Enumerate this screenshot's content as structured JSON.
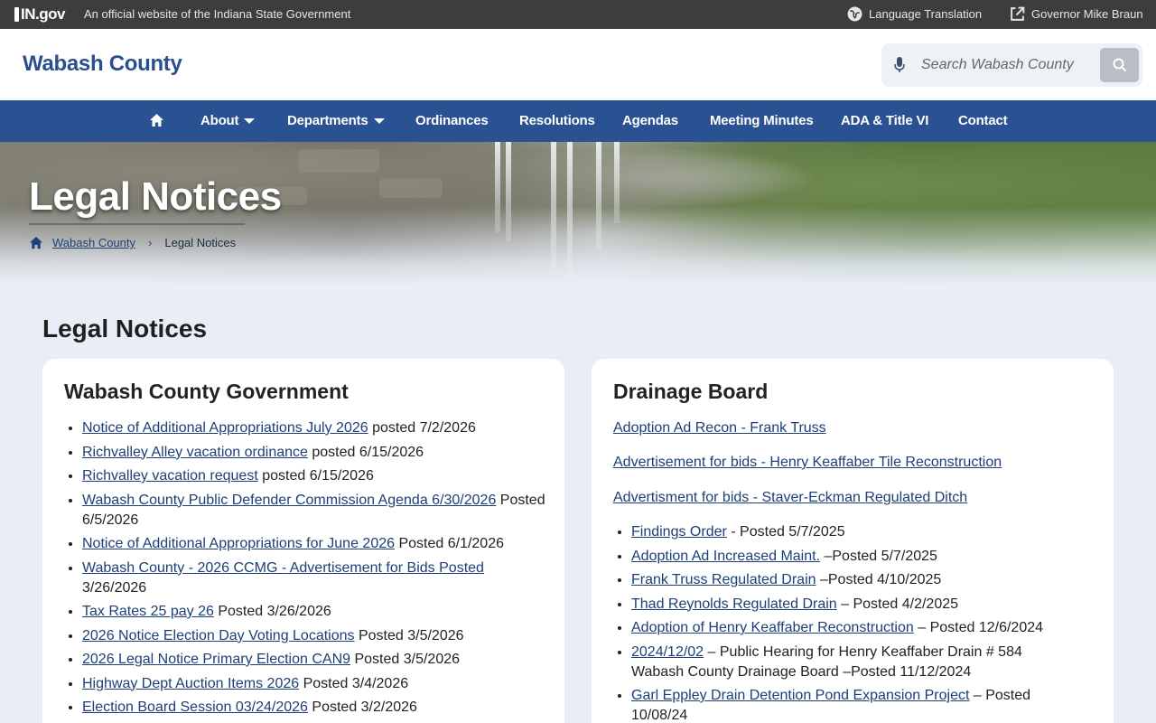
{
  "gov_bar": {
    "logo_text": "IN.gov",
    "official_text": "An official website of the Indiana State Government",
    "language_label": "Language Translation",
    "governor_label": "Governor Mike Braun"
  },
  "header": {
    "site_title": "Wabash County",
    "search_placeholder": "Search Wabash County"
  },
  "nav": {
    "items": [
      {
        "label": "About",
        "dropdown": true
      },
      {
        "label": "Departments",
        "dropdown": true
      },
      {
        "label": "Ordinances"
      },
      {
        "label": "Resolutions"
      },
      {
        "label": "Agendas"
      },
      {
        "label": "Meeting Minutes"
      },
      {
        "label": "ADA & Title VI"
      },
      {
        "label": "Contact"
      }
    ]
  },
  "hero": {
    "title": "Legal Notices",
    "breadcrumb_home": "Wabash County",
    "breadcrumb_current": "Legal Notices"
  },
  "main": {
    "heading": "Legal Notices"
  },
  "county_government": {
    "title": "Wabash County Government",
    "items": [
      {
        "link": "Notice of Additional Appropriations July 2026",
        "suffix": " posted 7/2/2026"
      },
      {
        "link": "Richvalley Alley vacation ordinance",
        "suffix": " posted 6/15/2026"
      },
      {
        "link": "Richvalley vacation request",
        "suffix": " posted 6/15/2026"
      },
      {
        "link": "Wabash County Public Defender Commission Agenda 6/30/2026",
        "suffix": " Posted 6/5/2026"
      },
      {
        "link": "Notice of Additional Appropriations  for June 2026",
        "suffix": " Posted 6/1/2026"
      },
      {
        "link": "Wabash County - 2026 CCMG -  Advertisement for Bids Posted",
        "suffix": " 3/26/2026"
      },
      {
        "link": "Tax Rates 25 pay  26",
        "suffix": " Posted 3/26/2026"
      },
      {
        "link": "2026 Notice Election Day Voting Locations",
        "suffix": " Posted 3/5/2026"
      },
      {
        "link": "2026 Legal Notice Primary Election CAN9",
        "suffix": " Posted 3/5/2026"
      },
      {
        "link": "Highway Dept  Auction Items 2026",
        "suffix": " Posted  3/4/2026"
      },
      {
        "link": "Election Board Session 03/24/2026",
        "suffix": " Posted 3/2/2026"
      }
    ]
  },
  "drainage_board": {
    "title": "Drainage Board",
    "links": [
      "Adoption Ad Recon - Frank Truss",
      "Advertisement for bids - Henry Keaffaber Tile Reconstruction",
      "Advertisment for bids - Staver-Eckman Regulated Ditch"
    ],
    "items": [
      {
        "link": "Findings Order",
        "suffix": " - Posted 5/7/2025"
      },
      {
        "link": "Adoption Ad Increased Maint.",
        "suffix": " –Posted 5/7/2025"
      },
      {
        "link": "Frank Truss Regulated Drain",
        "suffix": " –Posted 4/10/2025"
      },
      {
        "link": "Thad Reynolds Regulated Drain",
        "suffix": " – Posted 4/2/2025"
      },
      {
        "link": "Adoption of Henry Keaffaber Reconstruction",
        "suffix": " – Posted 12/6/2024"
      },
      {
        "link": "2024/12/02",
        "suffix": " – Public Hearing for Henry Keaffaber Drain # 584 Wabash County Drainage Board –Posted 11/12/2024"
      },
      {
        "link": "Garl Eppley Drain Detention Pond Expansion Project",
        "suffix": " – Posted 10/08/24"
      }
    ]
  }
}
